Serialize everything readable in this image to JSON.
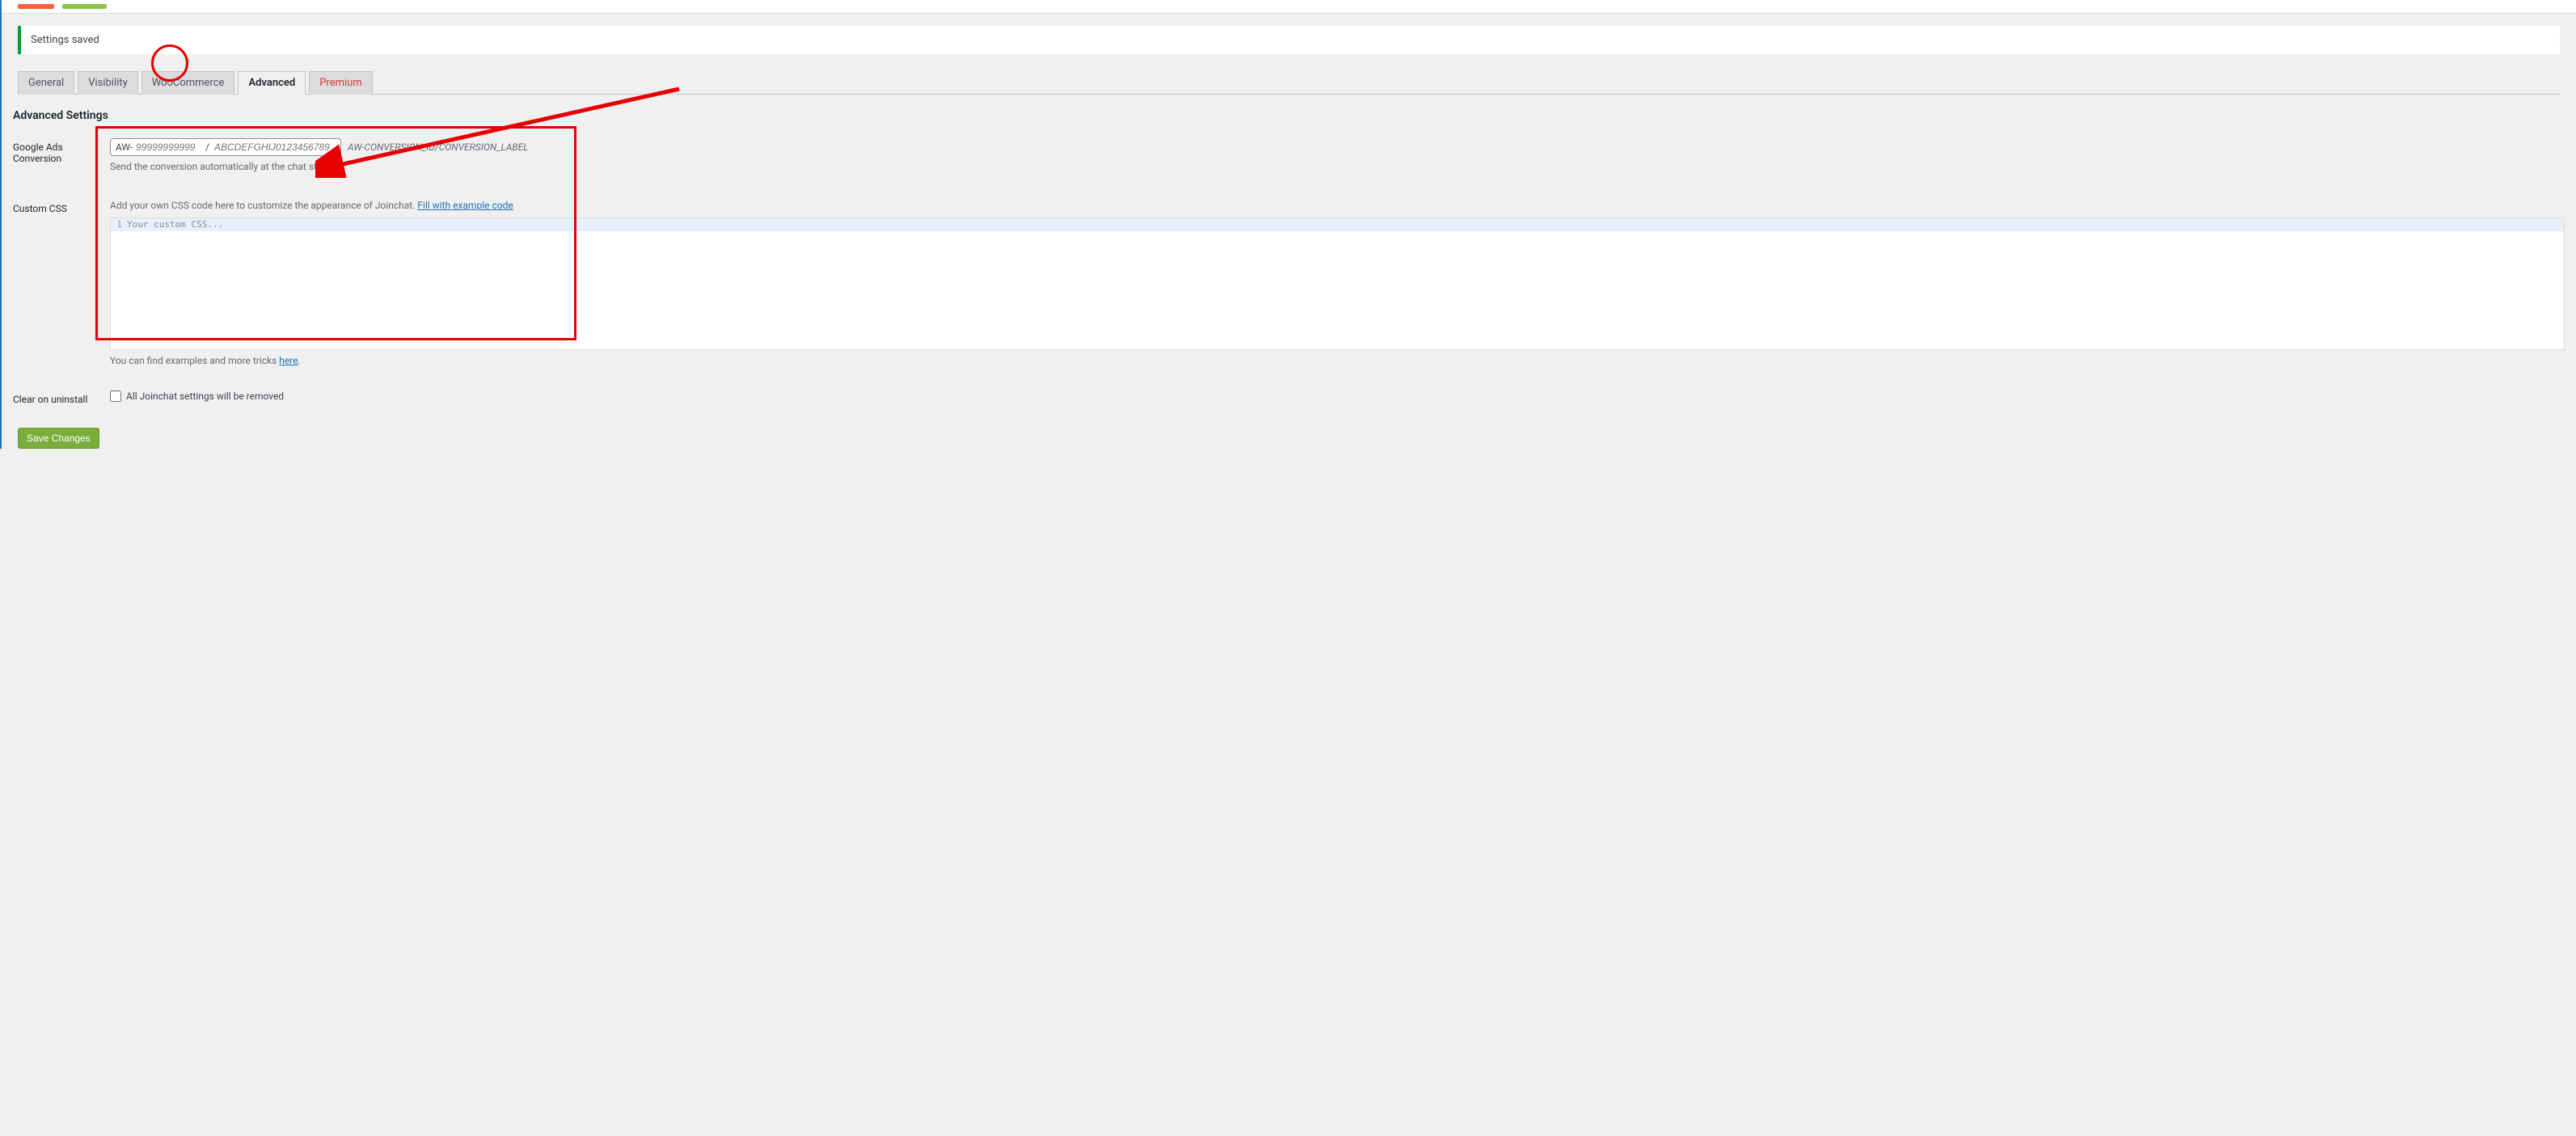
{
  "notice": {
    "saved": "Settings saved"
  },
  "tabs": {
    "general": "General",
    "visibility": "Visibility",
    "woocommerce": "WooCommerce",
    "advanced": "Advanced",
    "premium": "Premium"
  },
  "heading": "Advanced Settings",
  "google_ads": {
    "label": "Google Ads Conversion",
    "prefix": "AW-",
    "placeholder1": "99999999999",
    "slash": "/",
    "placeholder2": "ABCDEFGHIJ0123456789",
    "hint": "AW-CONVERSION_ID/CONVERSION_LABEL",
    "sub": "Send the conversion automatically at the chat start"
  },
  "custom_css": {
    "label": "Custom CSS",
    "intro": "Add your own CSS code here to customize the appearance of Joinchat. ",
    "fill_link": "Fill with example code",
    "line_num": "1",
    "placeholder": "Your custom CSS...",
    "examples_text": "You can find examples and more tricks ",
    "examples_link": "here",
    "examples_suffix": "."
  },
  "clear_uninstall": {
    "label": "Clear on uninstall",
    "checkbox_label": "All Joinchat settings will be removed"
  },
  "buttons": {
    "save": "Save Changes"
  }
}
